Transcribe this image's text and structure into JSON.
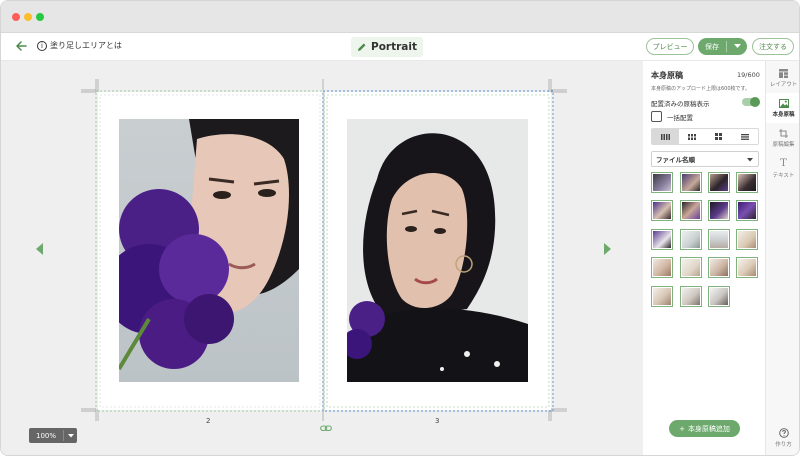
{
  "toolbar": {
    "bleed_help": "塗り足しエリアとは",
    "title": "Portrait",
    "preview": "プレビュー",
    "save": "保存",
    "order": "注文する"
  },
  "canvas": {
    "page_left_number": "2",
    "page_right_number": "3",
    "zoom": "100%"
  },
  "panel": {
    "title": "本身原稿",
    "count": "19/600",
    "upload_note": "本身原稿のアップロード上限は600枚です。",
    "show_placed_label": "配置済みの原稿表示",
    "show_placed_on": true,
    "bulk_place_label": "一括配置",
    "sort_label": "ファイル名順",
    "add_button": "本身原稿追加",
    "thumbnail_count": 19
  },
  "rail": {
    "layout": "レイアウト",
    "manuscript": "本身原稿",
    "edit": "原稿編集",
    "text": "テキスト",
    "help": "作り方"
  },
  "colors": {
    "accent": "#6da96c",
    "titlebar": "#e6e6e6",
    "canvas_bg": "#efefef"
  }
}
